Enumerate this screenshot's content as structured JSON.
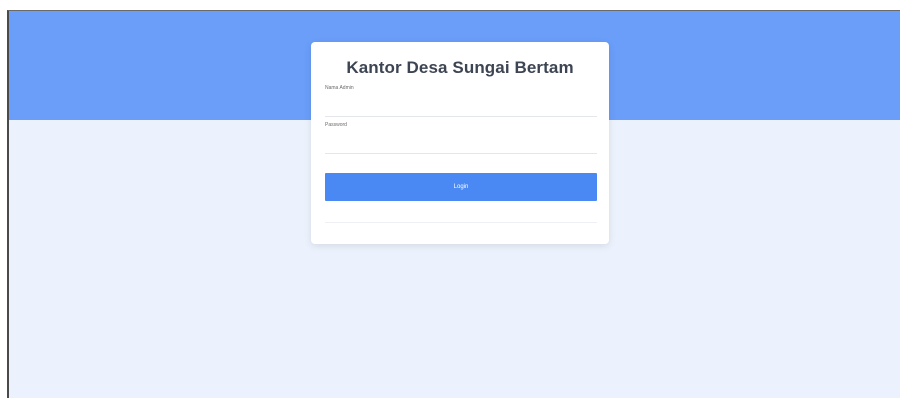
{
  "login_card": {
    "title": "Kantor Desa Sungai Bertam",
    "username_label": "Nama Admin",
    "username_value": "",
    "password_label": "Password",
    "password_value": "",
    "login_button_label": "Login"
  },
  "colors": {
    "hero_band": "#6a9ef9",
    "page_background": "#ecf2fd",
    "card_background": "#ffffff",
    "button_background": "#4a89f3",
    "title_text": "#3d4553"
  }
}
